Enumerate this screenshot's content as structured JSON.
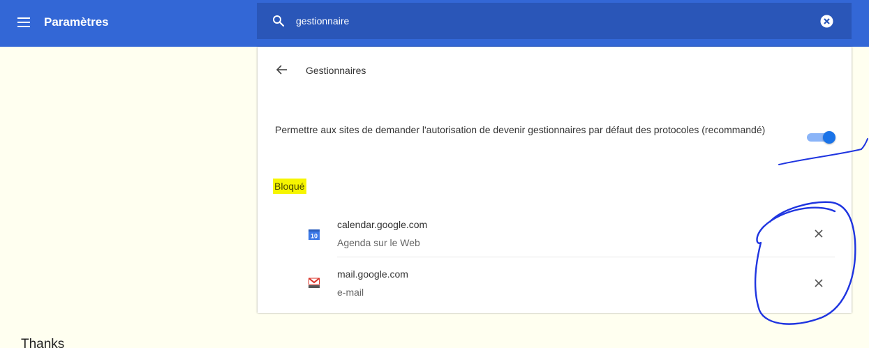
{
  "header": {
    "title": "Paramètres",
    "menu_icon": "hamburger-menu-icon",
    "search": {
      "value": "gestionnaire",
      "icon": "search-icon",
      "clear_icon": "clear-circle-icon"
    },
    "bar_color": "#3367d6"
  },
  "page": {
    "back_icon": "arrow-back-icon",
    "title": "Gestionnaires",
    "setting": {
      "label": "Permettre aux sites de demander l'autorisation de devenir gestionnaires par défaut des protocoles (recommandé)",
      "enabled": true,
      "accent_color": "#1a73e8"
    },
    "blocked": {
      "heading": "Bloqué",
      "highlight_color": "#f6f500",
      "sites": [
        {
          "name": "calendar.google.com",
          "description": "Agenda sur le Web",
          "icon": "google-calendar-icon",
          "remove_icon": "close-icon"
        },
        {
          "name": "mail.google.com",
          "description": "e-mail",
          "icon": "gmail-icon",
          "remove_icon": "close-icon"
        }
      ]
    }
  },
  "footer": {
    "text": "Thanks"
  },
  "annotation": {
    "color": "#1f35e0"
  }
}
